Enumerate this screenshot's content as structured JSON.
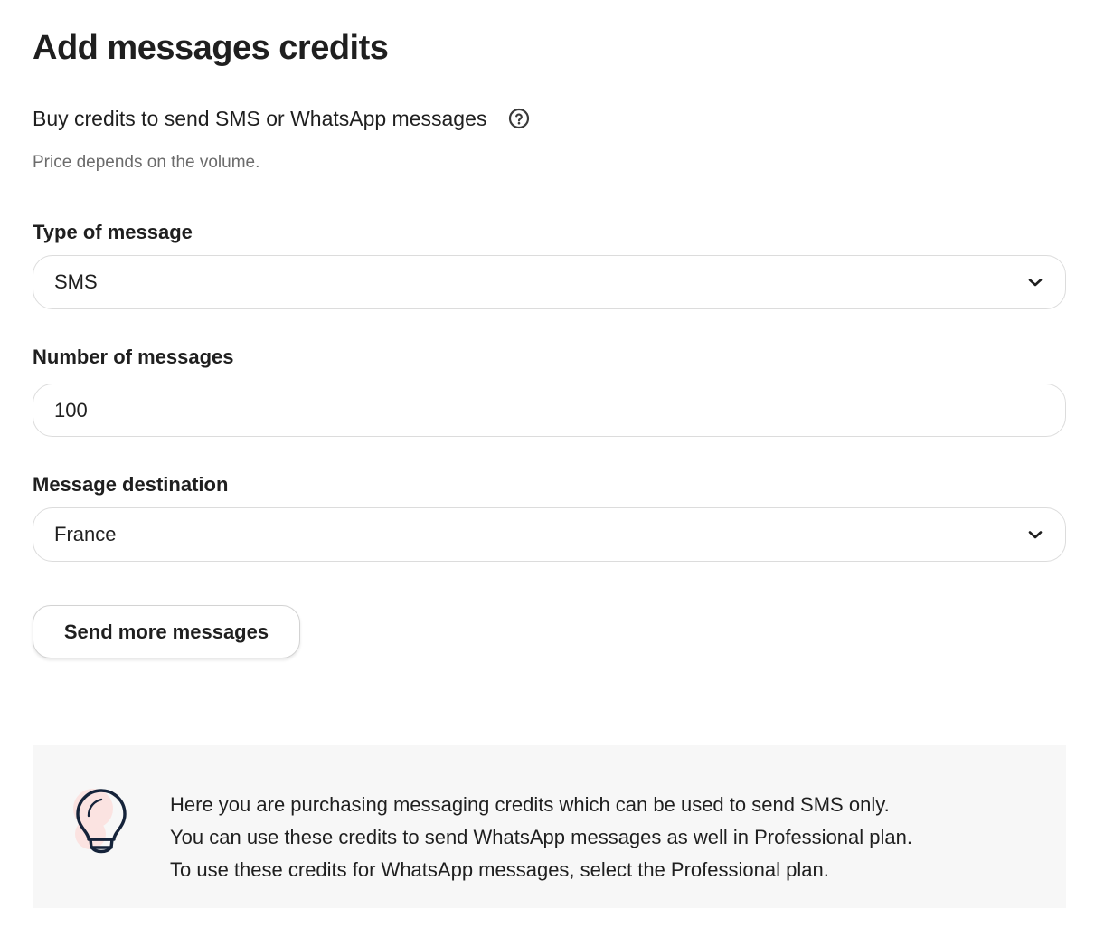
{
  "page": {
    "title": "Add messages credits",
    "subtitle": "Buy credits to send SMS or WhatsApp messages",
    "price_note": "Price depends on the volume."
  },
  "icons": {
    "help": "question-circle-icon",
    "chevron": "chevron-down-icon",
    "info": "lightbulb-icon"
  },
  "form": {
    "message_type": {
      "label": "Type of message",
      "value": "SMS"
    },
    "message_count": {
      "label": "Number of messages",
      "value": "100"
    },
    "destination": {
      "label": "Message destination",
      "value": "France"
    },
    "submit_label": "Send more messages"
  },
  "info_panel": {
    "lines": [
      "Here you are purchasing messaging credits which can be used to send SMS only.",
      "You can use these credits to send WhatsApp messages as well in Professional plan.",
      "To use these credits for WhatsApp messages, select the Professional plan."
    ]
  },
  "colors": {
    "text": "#1f1f1f",
    "muted_text": "#6b6b6b",
    "border": "#dcdcdc",
    "panel_bg": "#f7f7f7",
    "bulb_accent": "#fbe3e1",
    "bulb_stroke": "#15233a"
  }
}
